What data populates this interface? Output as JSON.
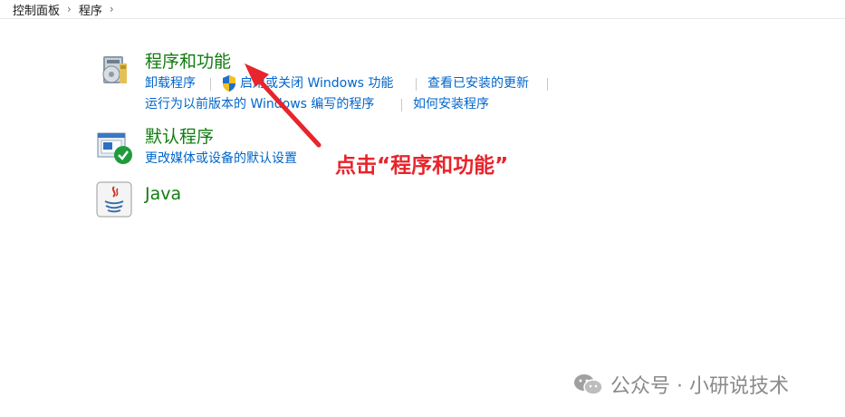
{
  "breadcrumb": {
    "items": [
      "控制面板",
      "程序"
    ],
    "separator": "›"
  },
  "categories": [
    {
      "title": "程序和功能",
      "icon": "programs-features-icon",
      "links": [
        "卸载程序",
        "启用或关闭 Windows 功能",
        "查看已安装的更新",
        "运行为以前版本的 Windows 编写的程序",
        "如何安装程序"
      ]
    },
    {
      "title": "默认程序",
      "icon": "default-programs-icon",
      "links": [
        "更改媒体或设备的默认设置"
      ]
    },
    {
      "title": "Java",
      "icon": "java-icon",
      "links": []
    }
  ],
  "annotation": {
    "text": "点击“程序和功能”",
    "color": "#e8242c"
  },
  "watermark": {
    "text": "公众号 · 小研说技术"
  },
  "colors": {
    "title_green": "#107c10",
    "link_blue": "#0066cc",
    "annotation_red": "#e8242c"
  }
}
